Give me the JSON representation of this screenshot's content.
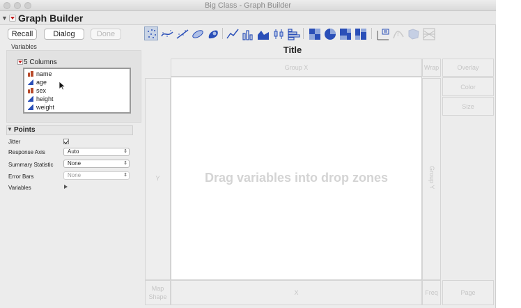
{
  "window": {
    "title": "Big Class - Graph Builder"
  },
  "header": {
    "title": "Graph Builder"
  },
  "buttons": {
    "recall": "Recall",
    "dialog": "Dialog",
    "done": "Done"
  },
  "variables": {
    "section_label": "Variables",
    "columns_label": "5 Columns",
    "columns": [
      {
        "name": "name",
        "type": "nominal"
      },
      {
        "name": "age",
        "type": "ordinal"
      },
      {
        "name": "sex",
        "type": "nominal"
      },
      {
        "name": "height",
        "type": "continuous"
      },
      {
        "name": "weight",
        "type": "continuous"
      }
    ]
  },
  "points": {
    "title": "Points",
    "properties": [
      {
        "label": "Jitter",
        "kind": "checkbox",
        "checked": true
      },
      {
        "label": "Response Axis",
        "kind": "select",
        "value": "Auto"
      },
      {
        "label": "Summary Statistic",
        "kind": "select",
        "value": "None"
      },
      {
        "label": "Error Bars",
        "kind": "select",
        "value": "None",
        "disabled": true
      },
      {
        "label": "Variables",
        "kind": "disclosure"
      }
    ]
  },
  "toolbar": {
    "elements": [
      "points",
      "smoother",
      "line-of-fit",
      "ellipse",
      "contour",
      "line",
      "bar",
      "area",
      "box-plot",
      "histogram",
      "heatmap",
      "pie",
      "treemap",
      "mosaic",
      "caption-box",
      "formula",
      "map-shapes",
      "parallel"
    ],
    "active": "points"
  },
  "graph": {
    "title": "Title",
    "placeholder": "Drag variables into drop zones"
  },
  "drop_zones": {
    "group_x": "Group X",
    "wrap": "Wrap",
    "overlay": "Overlay",
    "color": "Color",
    "size": "Size",
    "y": "Y",
    "group_y": "Group Y",
    "map_shape": "Map Shape",
    "x": "X",
    "freq": "Freq",
    "page": "Page"
  },
  "colors": {
    "accent_red": "#c21b1b",
    "icon_blue": "#2a4fb8",
    "active_tool": "#c9d4e6"
  }
}
